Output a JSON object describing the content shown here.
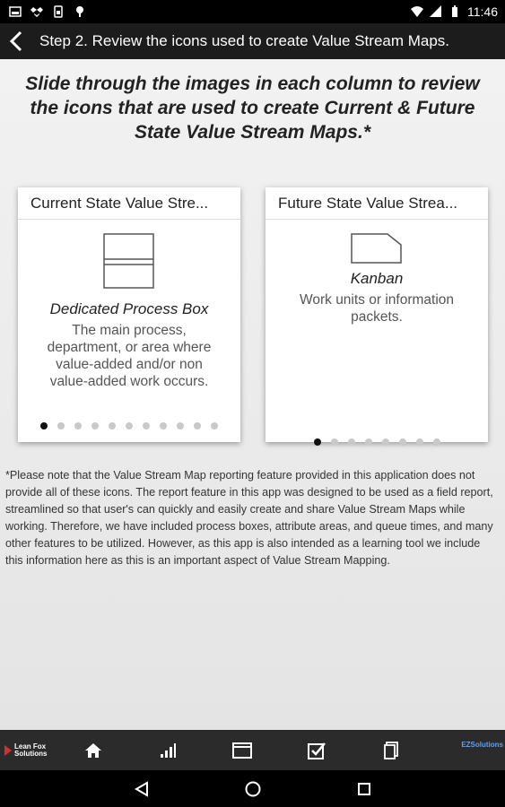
{
  "status_bar": {
    "time": "11:46",
    "left_icons": [
      "photo-icon",
      "dropbox-icon",
      "sim-icon",
      "android-icon"
    ],
    "right_icons": [
      "wifi-icon",
      "signal-icon",
      "battery-icon"
    ]
  },
  "app_bar": {
    "back_icon": "chevron-left-icon",
    "title": "Step 2. Review the icons used to create Value Stream Maps."
  },
  "intro": "Slide through the images in each column to review the icons that are used to create Current & Future State Value Stream Maps.*",
  "cards": {
    "current": {
      "header": "Current State Value Stre...",
      "icon": "dedicated-process-box-icon",
      "name": "Dedicated Process Box",
      "description": "The main process, department, or area where value-added and/or non value-added work occurs.",
      "dots_total": 11,
      "active_index": 0
    },
    "future": {
      "header": "Future State Value Strea...",
      "icon": "kanban-icon",
      "name": "Kanban",
      "description": "Work units or information packets.",
      "dots_total": 8,
      "active_index": 0
    }
  },
  "note": "*Please note that the Value Stream Map reporting feature provided in this application does not provide all of these icons. The report feature in this app was designed to be used as a field report, streamlined so that user's can quickly and easily create and share Value Stream Maps while working. Therefore, we have included process boxes, attribute areas, and queue times, and many other features to be utilized. However, as this app is also intended as a learning tool we include this information here as this is an important aspect of Value Stream Mapping.",
  "toolbar": {
    "logo_line1": "Lean Fox",
    "logo_line2": "Solutions",
    "buttons": [
      "home-icon",
      "signal-bars-icon",
      "window-icon",
      "checkbox-icon",
      "document-icon"
    ],
    "brand": "EZSolutions"
  },
  "nav_bar": {
    "buttons": [
      "back-triangle-icon",
      "home-circle-icon",
      "recents-square-icon"
    ]
  },
  "colors": {
    "app_bar": "#1c1c1c",
    "toolbar": "#2b2b2b",
    "brand": "#5aa0ff",
    "logo_accent": "#d32f2f"
  }
}
